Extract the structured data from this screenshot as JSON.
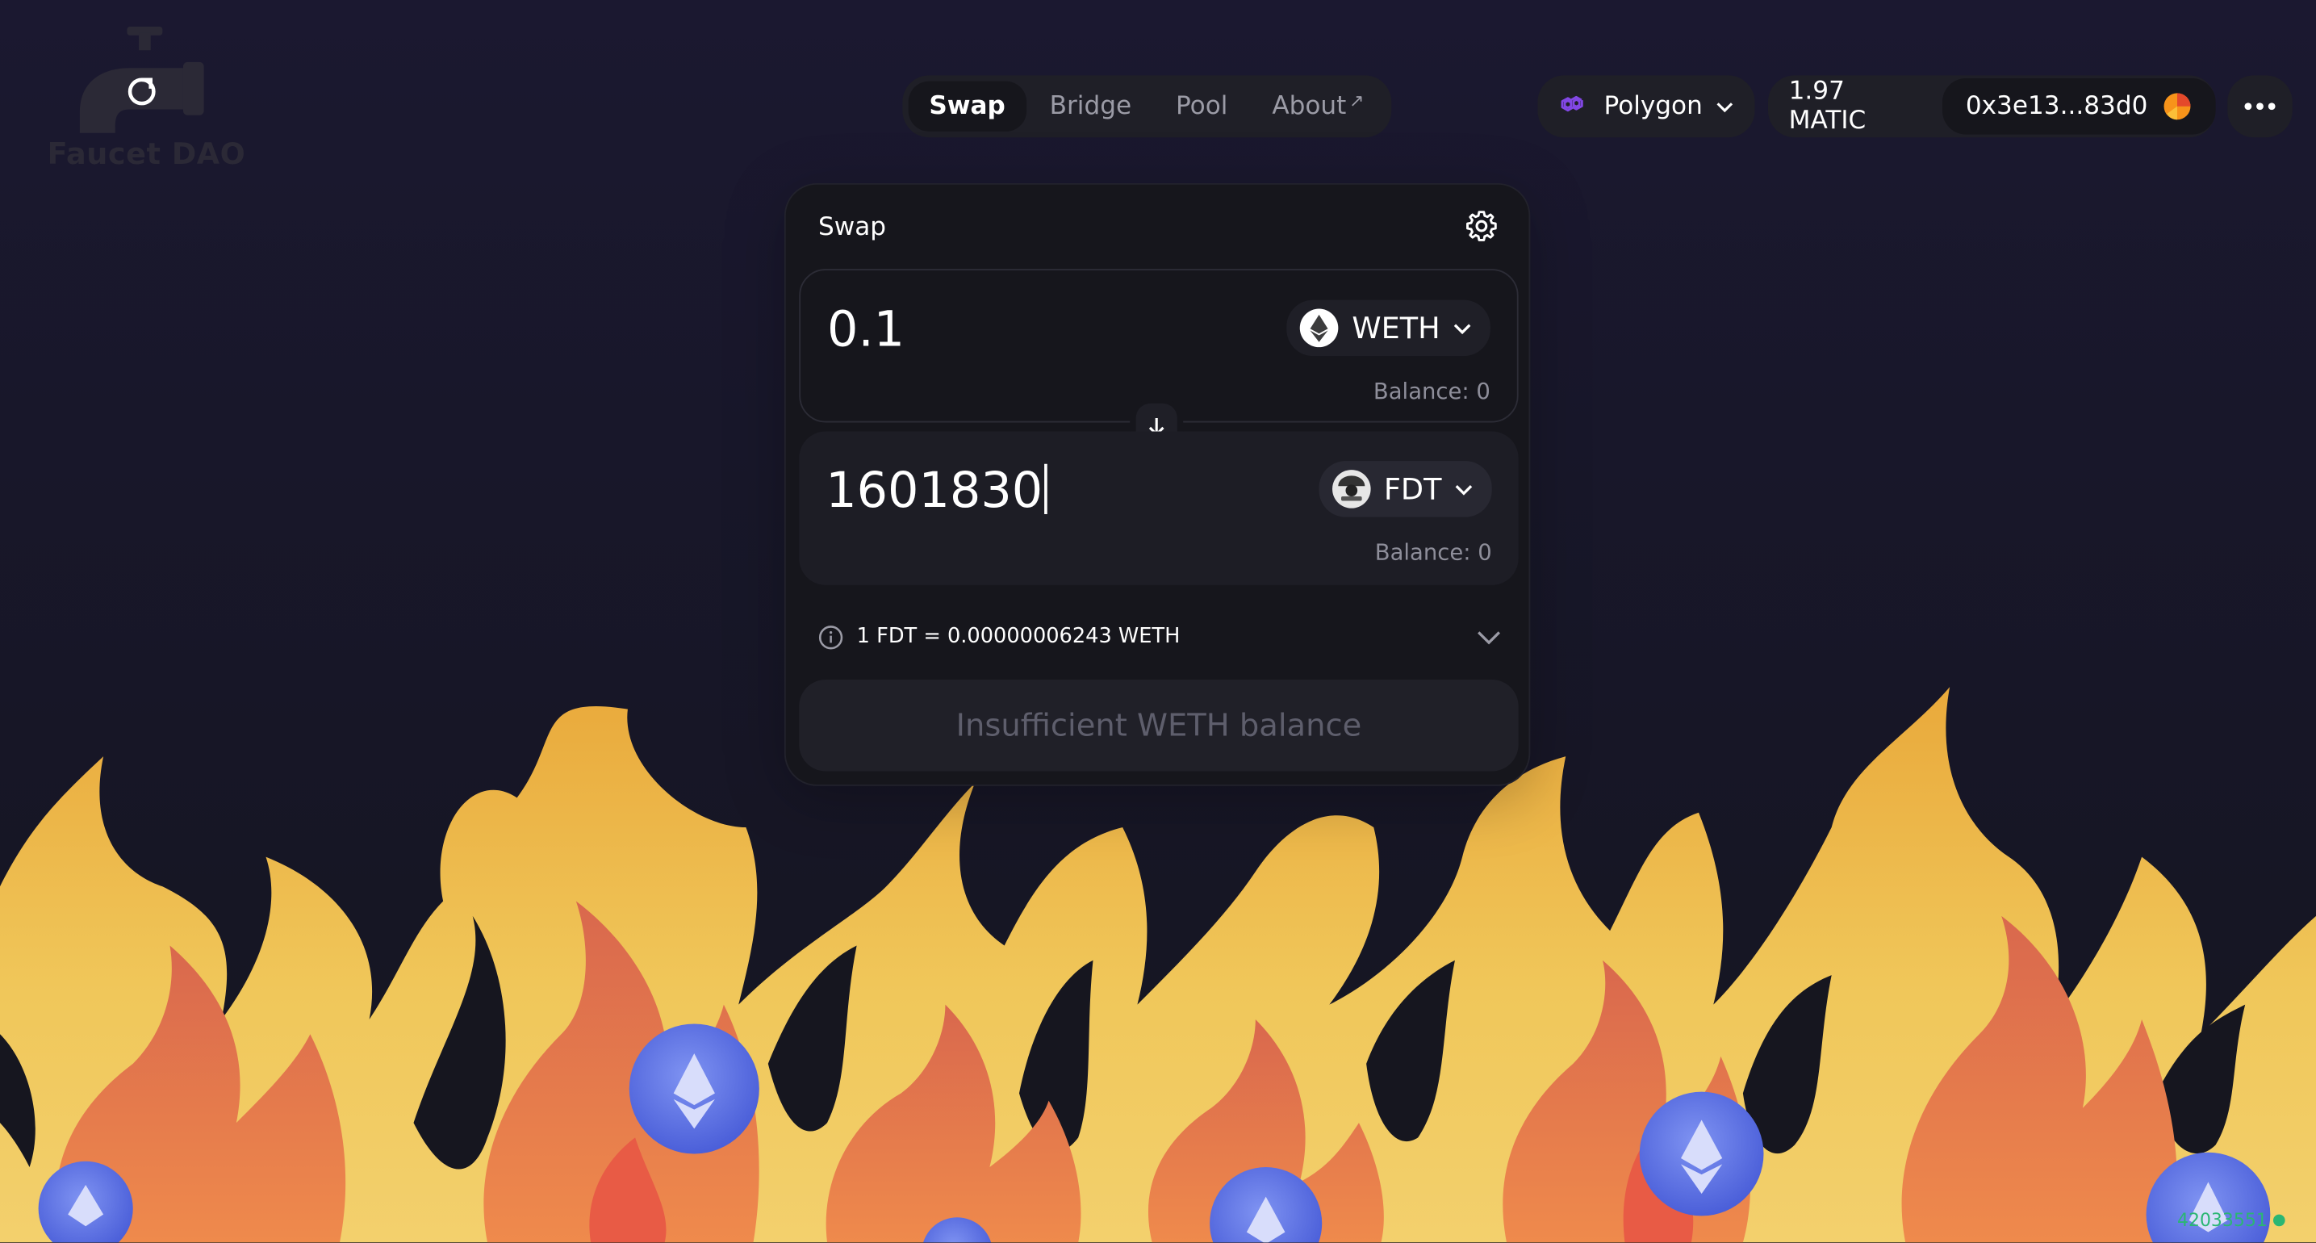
{
  "logo": {
    "text": "Faucet DAO",
    "icon": "faucet-icon"
  },
  "nav": {
    "items": [
      {
        "label": "Swap",
        "active": true
      },
      {
        "label": "Bridge",
        "active": false
      },
      {
        "label": "Pool",
        "active": false
      },
      {
        "label": "About",
        "active": false,
        "external": "↗"
      }
    ]
  },
  "network": {
    "label": "Polygon",
    "icon": "polygon-icon"
  },
  "wallet": {
    "balance": "1.97 MATIC",
    "address": "0x3e13...83d0"
  },
  "swap": {
    "title": "Swap",
    "input": {
      "amount": "0.1",
      "token": "WETH",
      "balance": "Balance: 0"
    },
    "output": {
      "amount": "1601830",
      "token": "FDT",
      "balance": "Balance: 0"
    },
    "rate": "1 FDT = 0.00000006243 WETH",
    "action": "Insufficient WETH balance"
  },
  "status": {
    "block": "42033551"
  },
  "colors": {
    "background": "#18172a",
    "card": "#16161c",
    "accent": "#8247e5",
    "flame_yellow": "#eec456",
    "flame_red": "#e4664b"
  }
}
